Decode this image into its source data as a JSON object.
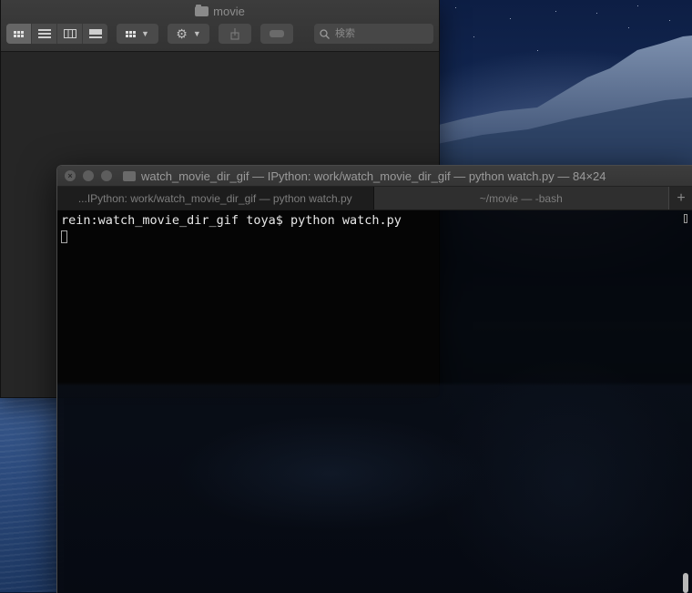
{
  "finder": {
    "title": "movie",
    "toolbar": {
      "view_icons": [
        "icon-view-icon",
        "list-view-icon",
        "column-view-icon",
        "gallery-view-icon"
      ],
      "group_icon": "group-by-icon",
      "action_icon": "gear-icon",
      "share_icon": "share-icon",
      "tag_icon": "tag-icon",
      "search_placeholder": "検索"
    }
  },
  "terminal": {
    "title": "watch_movie_dir_gif — IPython: work/watch_movie_dir_gif — python watch.py — 84×24",
    "tabs": [
      {
        "label": "...IPython: work/watch_movie_dir_gif — python watch.py"
      },
      {
        "label": "~/movie — -bash"
      }
    ],
    "add_tab_label": "+",
    "lines": [
      "rein:watch_movie_dir_gif toya$ python watch.py"
    ],
    "colors": {
      "background": "#000000",
      "text": "#e8e8e8"
    }
  }
}
